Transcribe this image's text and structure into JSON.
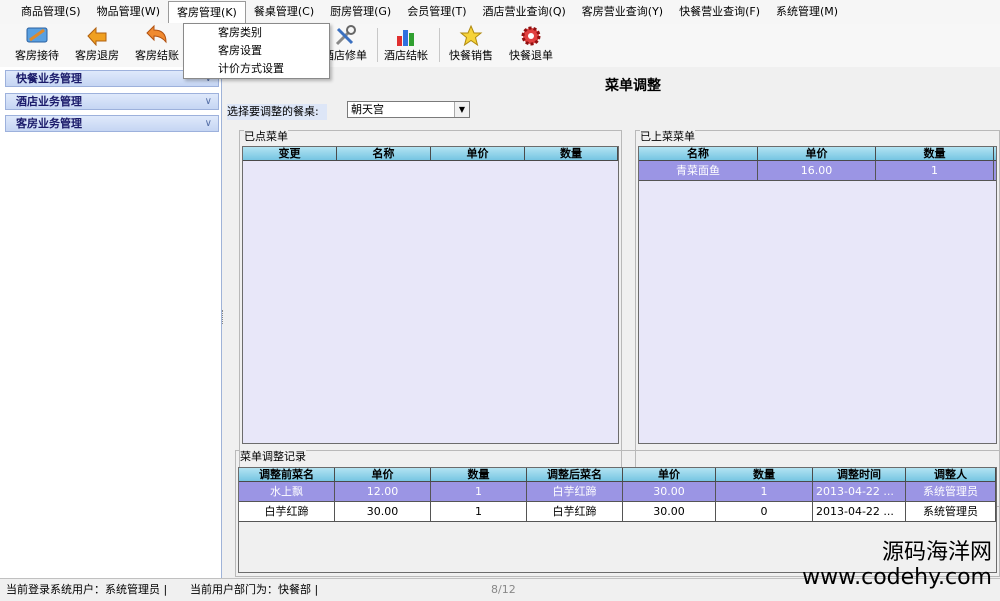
{
  "menu": [
    "商品管理(S)",
    "物品管理(W)",
    "客房管理(K)",
    "餐桌管理(C)",
    "厨房管理(G)",
    "会员管理(T)",
    "酒店营业查询(Q)",
    "客房营业查询(Y)",
    "快餐营业查询(F)",
    "系统管理(M)"
  ],
  "dropdown": [
    "客房类别",
    "客房设置",
    "计价方式设置"
  ],
  "toolbar": [
    "客房接待",
    "客房退房",
    "客房结账",
    "酒店修单",
    "酒店结帐",
    "快餐销售",
    "快餐退单"
  ],
  "sidebar": [
    "快餐业务管理",
    "酒店业务管理",
    "客房业务管理"
  ],
  "page_title": "菜单调整",
  "table_select": {
    "label": "选择要调整的餐桌:",
    "value": "朝天宫"
  },
  "ordered": {
    "title": "已点菜单",
    "columns": [
      "变更",
      "名称",
      "单价",
      "数量"
    ],
    "rows": []
  },
  "served": {
    "title": "已上菜菜单",
    "columns": [
      "名称",
      "单价",
      "数量"
    ],
    "rows": [
      [
        "青菜面鱼",
        "16.00",
        "1"
      ]
    ]
  },
  "log": {
    "title": "菜单调整记录",
    "columns": [
      "调整前菜名",
      "单价",
      "数量",
      "调整后菜名",
      "单价",
      "数量",
      "调整时间",
      "调整人"
    ],
    "rows": [
      [
        "水上飘",
        "12.00",
        "1",
        "白芋红蹄",
        "30.00",
        "1",
        "2013-04-22 ...",
        "系统管理员"
      ],
      [
        "白芋红蹄",
        "30.00",
        "1",
        "白芋红蹄",
        "30.00",
        "0",
        "2013-04-22 ...",
        "系统管理员"
      ]
    ]
  },
  "status": {
    "user": "当前登录系统用户：系统管理员 |",
    "dept": "当前用户部门为：快餐部 |",
    "page": "8/12"
  },
  "watermark": {
    "line1": "源码海洋网",
    "line2": "www.codehy.com"
  }
}
